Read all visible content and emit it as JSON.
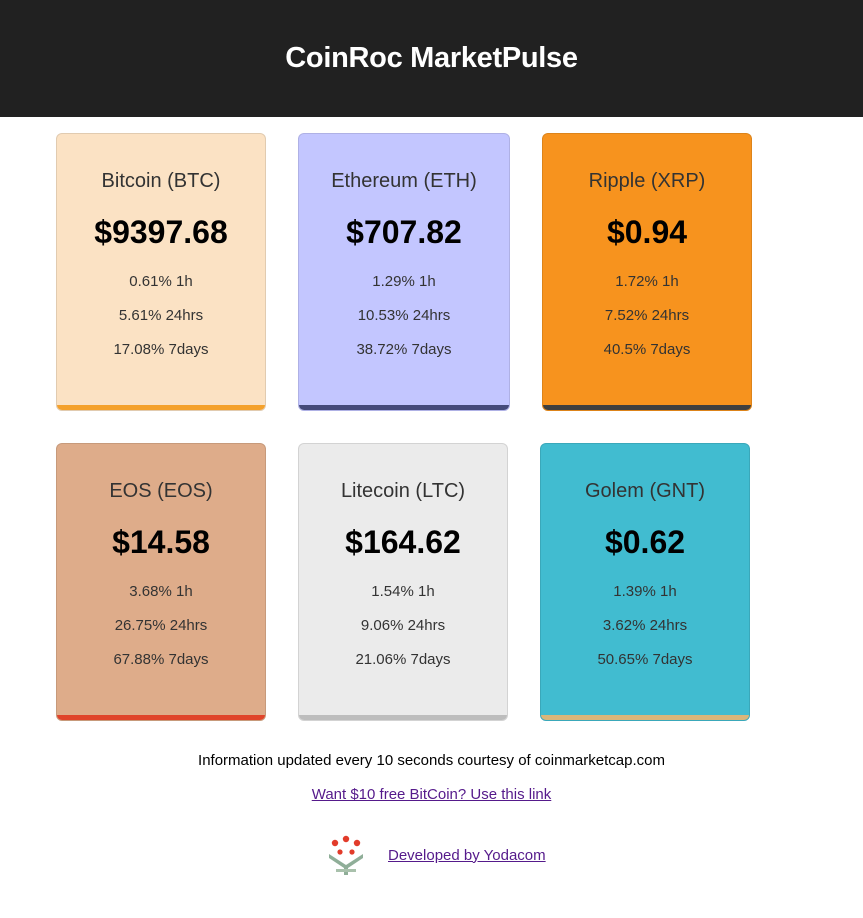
{
  "header": {
    "title": "CoinRoc MarketPulse"
  },
  "coins": [
    {
      "name": "Bitcoin (BTC)",
      "price": "$9397.68",
      "change_1h": "0.61% 1h",
      "change_24h": "5.61% 24hrs",
      "change_7d": "17.08% 7days",
      "bg_color": "#fbe2c4",
      "bar_color": "#f4a12c"
    },
    {
      "name": "Ethereum (ETH)",
      "price": "$707.82",
      "change_1h": "1.29% 1h",
      "change_24h": "10.53% 24hrs",
      "change_7d": "38.72% 7days",
      "bg_color": "#c3c6ff",
      "bar_color": "#454a7a"
    },
    {
      "name": "Ripple (XRP)",
      "price": "$0.94",
      "change_1h": "1.72% 1h",
      "change_24h": "7.52% 24hrs",
      "change_7d": "40.5% 7days",
      "bg_color": "#f7931e",
      "bar_color": "#3f3f3f"
    },
    {
      "name": "EOS (EOS)",
      "price": "$14.58",
      "change_1h": "3.68% 1h",
      "change_24h": "26.75% 24hrs",
      "change_7d": "67.88% 7days",
      "bg_color": "#deac8a",
      "bar_color": "#e0442a"
    },
    {
      "name": "Litecoin (LTC)",
      "price": "$164.62",
      "change_1h": "1.54% 1h",
      "change_24h": "9.06% 24hrs",
      "change_7d": "21.06% 7days",
      "bg_color": "#ebebeb",
      "bar_color": "#bdbdbd"
    },
    {
      "name": "Golem (GNT)",
      "price": "$0.62",
      "change_1h": "1.39% 1h",
      "change_24h": "3.62% 24hrs",
      "change_7d": "50.65% 7days",
      "bg_color": "#41bcd0",
      "bar_color": "#d9b67a"
    }
  ],
  "footer": {
    "info": "Information updated every 10 seconds courtesy of coinmarketcap.com",
    "free_bitcoin_link": "Want $10 free BitCoin? Use this link",
    "developer_link": "Developed by Yodacom",
    "logo_icon": "yodacom-logo-icon"
  }
}
